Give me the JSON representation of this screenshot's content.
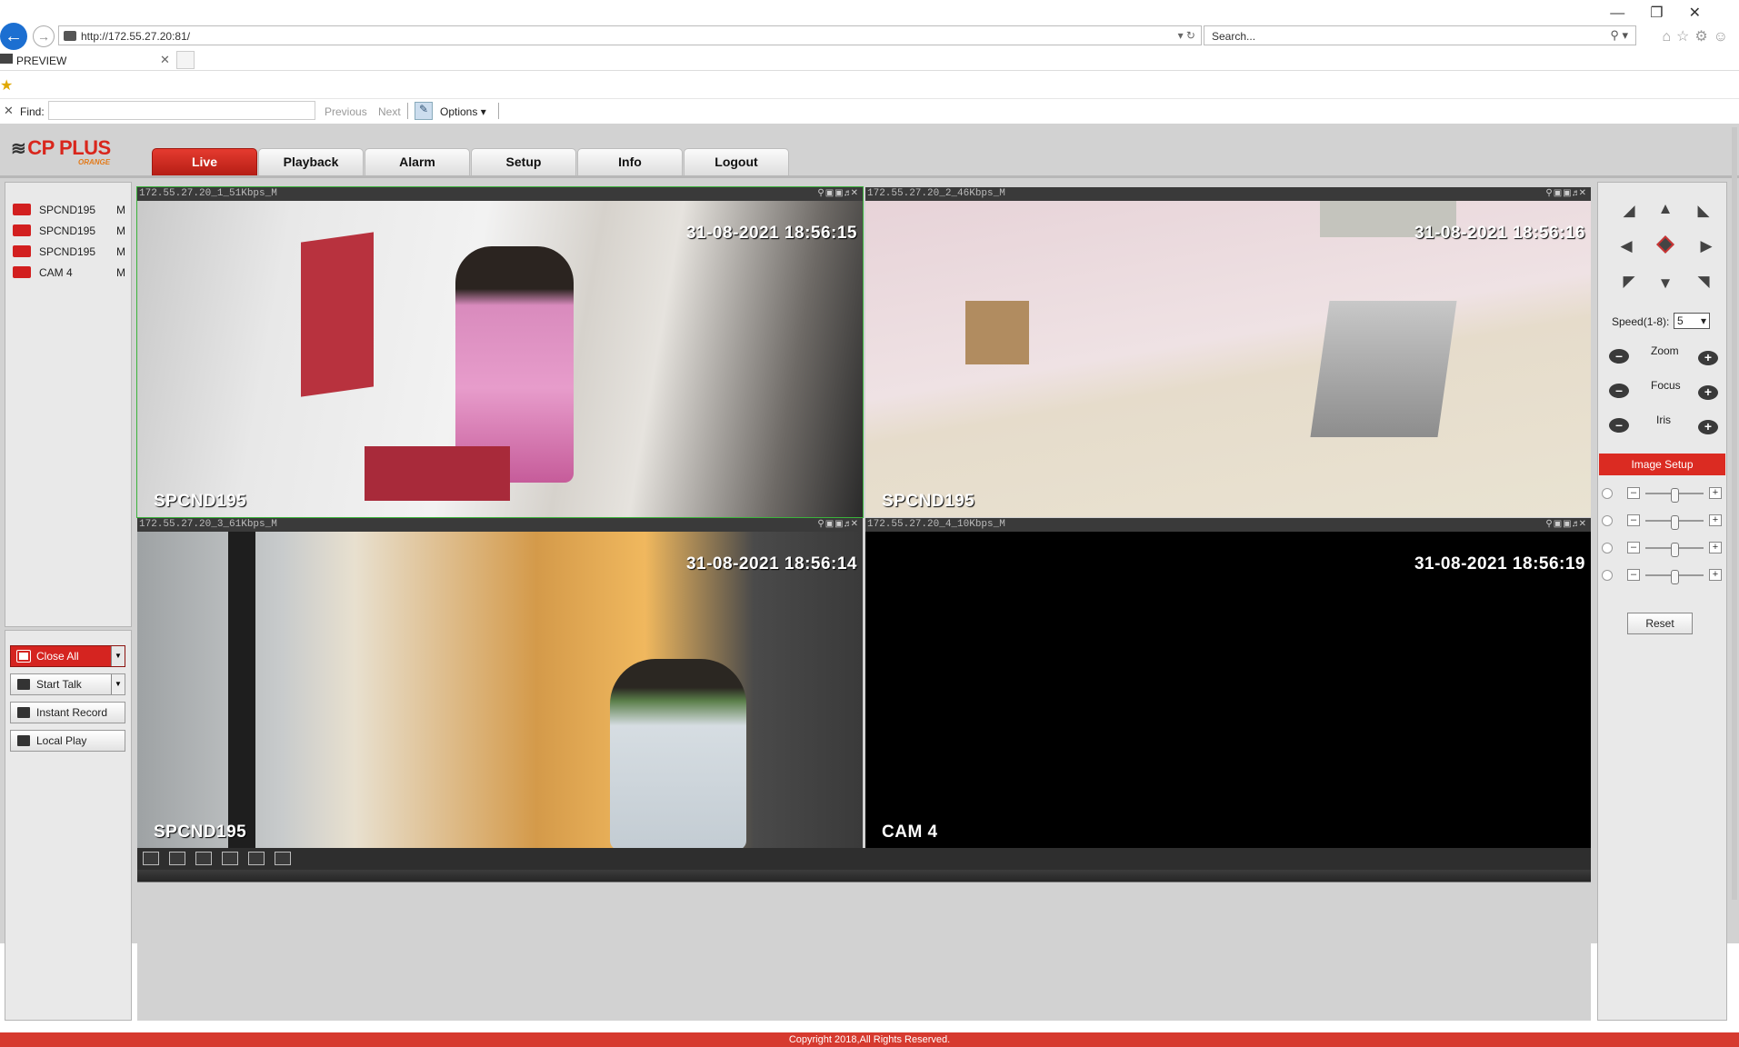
{
  "browser": {
    "url": "http://172.55.27.20:81/",
    "search_placeholder": "Search...",
    "tab_title": "PREVIEW",
    "find_label": "Find:",
    "find_prev": "Previous",
    "find_next": "Next",
    "find_options": "Options"
  },
  "app": {
    "logo": "CP PLUS",
    "logo_sub": "ORANGE",
    "nav_tabs": [
      {
        "label": "Live",
        "active": true
      },
      {
        "label": "Playback"
      },
      {
        "label": "Alarm"
      },
      {
        "label": "Setup"
      },
      {
        "label": "Info"
      },
      {
        "label": "Logout"
      }
    ],
    "cameras": [
      {
        "name": "SPCND195",
        "stream": "M"
      },
      {
        "name": "SPCND195",
        "stream": "M"
      },
      {
        "name": "SPCND195",
        "stream": "M"
      },
      {
        "name": "CAM 4",
        "stream": "M"
      }
    ],
    "controls": {
      "close_all": "Close All",
      "start_talk": "Start Talk",
      "instant_record": "Instant Record",
      "local_play": "Local Play"
    },
    "panes": [
      {
        "info": "172.55.27.20_1_51Kbps_M",
        "timestamp": "31-08-2021 18:56:15",
        "label": "SPCND195"
      },
      {
        "info": "172.55.27.20_2_46Kbps_M",
        "timestamp": "31-08-2021 18:56:16",
        "label": "SPCND195"
      },
      {
        "info": "172.55.27.20_3_61Kbps_M",
        "timestamp": "31-08-2021 18:56:14",
        "label": "SPCND195"
      },
      {
        "info": "172.55.27.20_4_10Kbps_M",
        "timestamp": "31-08-2021 18:56:19",
        "label": "CAM 4"
      }
    ],
    "ptz": {
      "speed_label": "Speed(1-8):",
      "speed_value": "5",
      "zoom": "Zoom",
      "focus": "Focus",
      "iris": "Iris",
      "image_setup": "Image Setup",
      "reset": "Reset"
    },
    "copyright": "Copyright 2018,All Rights Reserved."
  },
  "colors": {
    "accent": "#d9261c",
    "selected_pane": "#3bb33b"
  }
}
